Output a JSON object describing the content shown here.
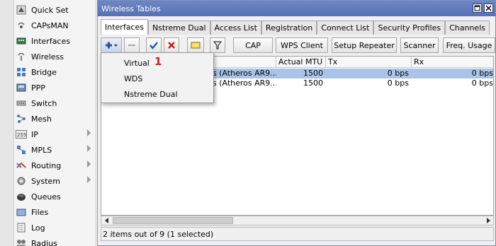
{
  "left_menu": {
    "items": [
      {
        "label": "Quick Set",
        "icon": "quick-set-icon",
        "arrow": false
      },
      {
        "label": "CAPsMAN",
        "icon": "capsman-icon",
        "arrow": false
      },
      {
        "label": "Interfaces",
        "icon": "interfaces-icon",
        "arrow": false
      },
      {
        "label": "Wireless",
        "icon": "wireless-icon",
        "arrow": false
      },
      {
        "label": "Bridge",
        "icon": "bridge-icon",
        "arrow": false
      },
      {
        "label": "PPP",
        "icon": "ppp-icon",
        "arrow": false
      },
      {
        "label": "Switch",
        "icon": "switch-icon",
        "arrow": false
      },
      {
        "label": "Mesh",
        "icon": "mesh-icon",
        "arrow": false
      },
      {
        "label": "IP",
        "icon": "ip-icon",
        "arrow": true
      },
      {
        "label": "MPLS",
        "icon": "mpls-icon",
        "arrow": true
      },
      {
        "label": "Routing",
        "icon": "routing-icon",
        "arrow": true
      },
      {
        "label": "System",
        "icon": "system-icon",
        "arrow": true
      },
      {
        "label": "Queues",
        "icon": "queues-icon",
        "arrow": false
      },
      {
        "label": "Files",
        "icon": "files-icon",
        "arrow": false
      },
      {
        "label": "Log",
        "icon": "log-icon",
        "arrow": false
      },
      {
        "label": "Radius",
        "icon": "radius-icon",
        "arrow": false
      }
    ]
  },
  "window": {
    "title": "Wireless Tables",
    "tabs": [
      {
        "label": "Interfaces",
        "active": true
      },
      {
        "label": "Nstreme Dual",
        "active": false
      },
      {
        "label": "Access List",
        "active": false
      },
      {
        "label": "Registration",
        "active": false
      },
      {
        "label": "Connect List",
        "active": false
      },
      {
        "label": "Security Profiles",
        "active": false
      },
      {
        "label": "Channels",
        "active": false
      }
    ],
    "toolbar": {
      "cap_label": "CAP",
      "wps_label": "WPS Client",
      "setup_repeater_label": "Setup Repeater",
      "scanner_label": "Scanner",
      "freq_usage_label": "Freq. Usage"
    },
    "table": {
      "columns": [
        "Actual MTU",
        "Tx",
        "Rx"
      ],
      "rows": [
        {
          "type_partial": "s (Atheros AR9...",
          "mtu": "1500",
          "tx": "0 bps",
          "rx": "0 bps",
          "selected": true
        },
        {
          "type_partial": "s (Atheros AR9...",
          "mtu": "1500",
          "tx": "0 bps",
          "rx": "0 bps",
          "selected": false
        }
      ]
    },
    "status": "2 items out of 9 (1 selected)"
  },
  "add_menu": {
    "items": [
      "Virtual",
      "WDS",
      "Nstreme Dual"
    ],
    "badge": "1"
  },
  "colors": {
    "titlebar": "#5e78b9",
    "selected_row": "#a9c4e8",
    "add_icon": "#2a4f9c",
    "check_icon": "#1d4fb0",
    "cross_icon": "#d01818",
    "badge": "#d81b1b"
  }
}
